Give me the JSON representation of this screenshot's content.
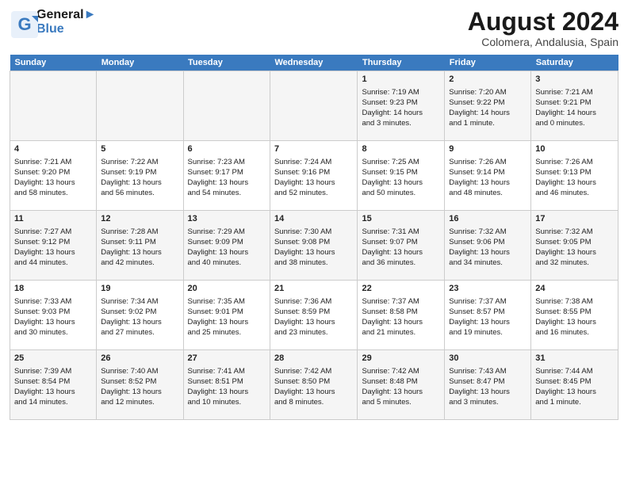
{
  "logo": {
    "line1": "General",
    "line2": "Blue"
  },
  "title": "August 2024",
  "location": "Colomera, Andalusia, Spain",
  "days_of_week": [
    "Sunday",
    "Monday",
    "Tuesday",
    "Wednesday",
    "Thursday",
    "Friday",
    "Saturday"
  ],
  "weeks": [
    [
      {
        "day": "",
        "content": ""
      },
      {
        "day": "",
        "content": ""
      },
      {
        "day": "",
        "content": ""
      },
      {
        "day": "",
        "content": ""
      },
      {
        "day": "1",
        "content": "Sunrise: 7:19 AM\nSunset: 9:23 PM\nDaylight: 14 hours\nand 3 minutes."
      },
      {
        "day": "2",
        "content": "Sunrise: 7:20 AM\nSunset: 9:22 PM\nDaylight: 14 hours\nand 1 minute."
      },
      {
        "day": "3",
        "content": "Sunrise: 7:21 AM\nSunset: 9:21 PM\nDaylight: 14 hours\nand 0 minutes."
      }
    ],
    [
      {
        "day": "4",
        "content": "Sunrise: 7:21 AM\nSunset: 9:20 PM\nDaylight: 13 hours\nand 58 minutes."
      },
      {
        "day": "5",
        "content": "Sunrise: 7:22 AM\nSunset: 9:19 PM\nDaylight: 13 hours\nand 56 minutes."
      },
      {
        "day": "6",
        "content": "Sunrise: 7:23 AM\nSunset: 9:17 PM\nDaylight: 13 hours\nand 54 minutes."
      },
      {
        "day": "7",
        "content": "Sunrise: 7:24 AM\nSunset: 9:16 PM\nDaylight: 13 hours\nand 52 minutes."
      },
      {
        "day": "8",
        "content": "Sunrise: 7:25 AM\nSunset: 9:15 PM\nDaylight: 13 hours\nand 50 minutes."
      },
      {
        "day": "9",
        "content": "Sunrise: 7:26 AM\nSunset: 9:14 PM\nDaylight: 13 hours\nand 48 minutes."
      },
      {
        "day": "10",
        "content": "Sunrise: 7:26 AM\nSunset: 9:13 PM\nDaylight: 13 hours\nand 46 minutes."
      }
    ],
    [
      {
        "day": "11",
        "content": "Sunrise: 7:27 AM\nSunset: 9:12 PM\nDaylight: 13 hours\nand 44 minutes."
      },
      {
        "day": "12",
        "content": "Sunrise: 7:28 AM\nSunset: 9:11 PM\nDaylight: 13 hours\nand 42 minutes."
      },
      {
        "day": "13",
        "content": "Sunrise: 7:29 AM\nSunset: 9:09 PM\nDaylight: 13 hours\nand 40 minutes."
      },
      {
        "day": "14",
        "content": "Sunrise: 7:30 AM\nSunset: 9:08 PM\nDaylight: 13 hours\nand 38 minutes."
      },
      {
        "day": "15",
        "content": "Sunrise: 7:31 AM\nSunset: 9:07 PM\nDaylight: 13 hours\nand 36 minutes."
      },
      {
        "day": "16",
        "content": "Sunrise: 7:32 AM\nSunset: 9:06 PM\nDaylight: 13 hours\nand 34 minutes."
      },
      {
        "day": "17",
        "content": "Sunrise: 7:32 AM\nSunset: 9:05 PM\nDaylight: 13 hours\nand 32 minutes."
      }
    ],
    [
      {
        "day": "18",
        "content": "Sunrise: 7:33 AM\nSunset: 9:03 PM\nDaylight: 13 hours\nand 30 minutes."
      },
      {
        "day": "19",
        "content": "Sunrise: 7:34 AM\nSunset: 9:02 PM\nDaylight: 13 hours\nand 27 minutes."
      },
      {
        "day": "20",
        "content": "Sunrise: 7:35 AM\nSunset: 9:01 PM\nDaylight: 13 hours\nand 25 minutes."
      },
      {
        "day": "21",
        "content": "Sunrise: 7:36 AM\nSunset: 8:59 PM\nDaylight: 13 hours\nand 23 minutes."
      },
      {
        "day": "22",
        "content": "Sunrise: 7:37 AM\nSunset: 8:58 PM\nDaylight: 13 hours\nand 21 minutes."
      },
      {
        "day": "23",
        "content": "Sunrise: 7:37 AM\nSunset: 8:57 PM\nDaylight: 13 hours\nand 19 minutes."
      },
      {
        "day": "24",
        "content": "Sunrise: 7:38 AM\nSunset: 8:55 PM\nDaylight: 13 hours\nand 16 minutes."
      }
    ],
    [
      {
        "day": "25",
        "content": "Sunrise: 7:39 AM\nSunset: 8:54 PM\nDaylight: 13 hours\nand 14 minutes."
      },
      {
        "day": "26",
        "content": "Sunrise: 7:40 AM\nSunset: 8:52 PM\nDaylight: 13 hours\nand 12 minutes."
      },
      {
        "day": "27",
        "content": "Sunrise: 7:41 AM\nSunset: 8:51 PM\nDaylight: 13 hours\nand 10 minutes."
      },
      {
        "day": "28",
        "content": "Sunrise: 7:42 AM\nSunset: 8:50 PM\nDaylight: 13 hours\nand 8 minutes."
      },
      {
        "day": "29",
        "content": "Sunrise: 7:42 AM\nSunset: 8:48 PM\nDaylight: 13 hours\nand 5 minutes."
      },
      {
        "day": "30",
        "content": "Sunrise: 7:43 AM\nSunset: 8:47 PM\nDaylight: 13 hours\nand 3 minutes."
      },
      {
        "day": "31",
        "content": "Sunrise: 7:44 AM\nSunset: 8:45 PM\nDaylight: 13 hours\nand 1 minute."
      }
    ]
  ]
}
